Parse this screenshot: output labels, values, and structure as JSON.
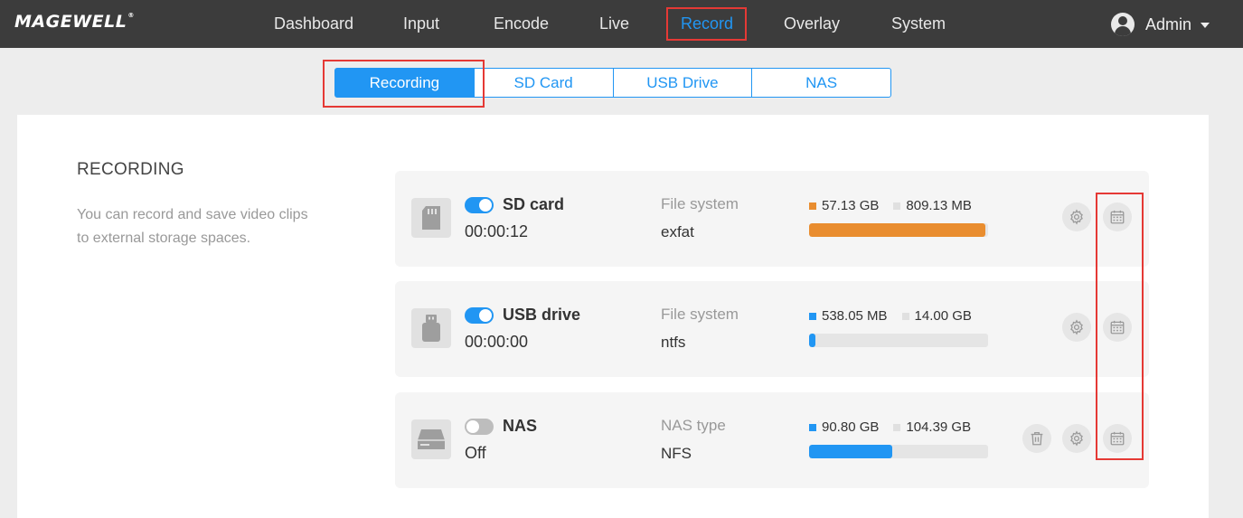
{
  "app": {
    "logo": "MAGEWELL",
    "logo_mark": "®"
  },
  "nav": {
    "items": [
      {
        "label": "Dashboard"
      },
      {
        "label": "Input"
      },
      {
        "label": "Encode"
      },
      {
        "label": "Live"
      },
      {
        "label": "Record",
        "active": true
      },
      {
        "label": "Overlay"
      },
      {
        "label": "System"
      }
    ],
    "user": "Admin"
  },
  "subtabs": [
    {
      "label": "Recording",
      "active": true
    },
    {
      "label": "SD Card"
    },
    {
      "label": "USB Drive"
    },
    {
      "label": "NAS"
    }
  ],
  "section": {
    "title": "RECORDING",
    "description": "You can record and save video clips to external storage spaces."
  },
  "devices": [
    {
      "name": "SD card",
      "enabled": true,
      "status": "00:00:12",
      "fs_label": "File system",
      "fs_value": "exfat",
      "used": "57.13 GB",
      "free": "809.13 MB",
      "used_fraction": 0.986,
      "bar_color": "#e98d2f",
      "icon": "sd-card-icon"
    },
    {
      "name": "USB drive",
      "enabled": true,
      "status": "00:00:00",
      "fs_label": "File system",
      "fs_value": "ntfs",
      "used": "538.05 MB",
      "free": "14.00 GB",
      "used_fraction": 0.036,
      "bar_color": "#2196f3",
      "icon": "usb-drive-icon"
    },
    {
      "name": "NAS",
      "enabled": false,
      "status": "Off",
      "fs_label": "NAS type",
      "fs_value": "NFS",
      "used": "90.80 GB",
      "free": "104.39 GB",
      "used_fraction": 0.465,
      "bar_color": "#2196f3",
      "icon": "nas-drive-icon",
      "deletable": true
    }
  ],
  "colors": {
    "accent": "#2196f3",
    "highlight": "#e53935",
    "topbar": "#3c3c3c"
  }
}
